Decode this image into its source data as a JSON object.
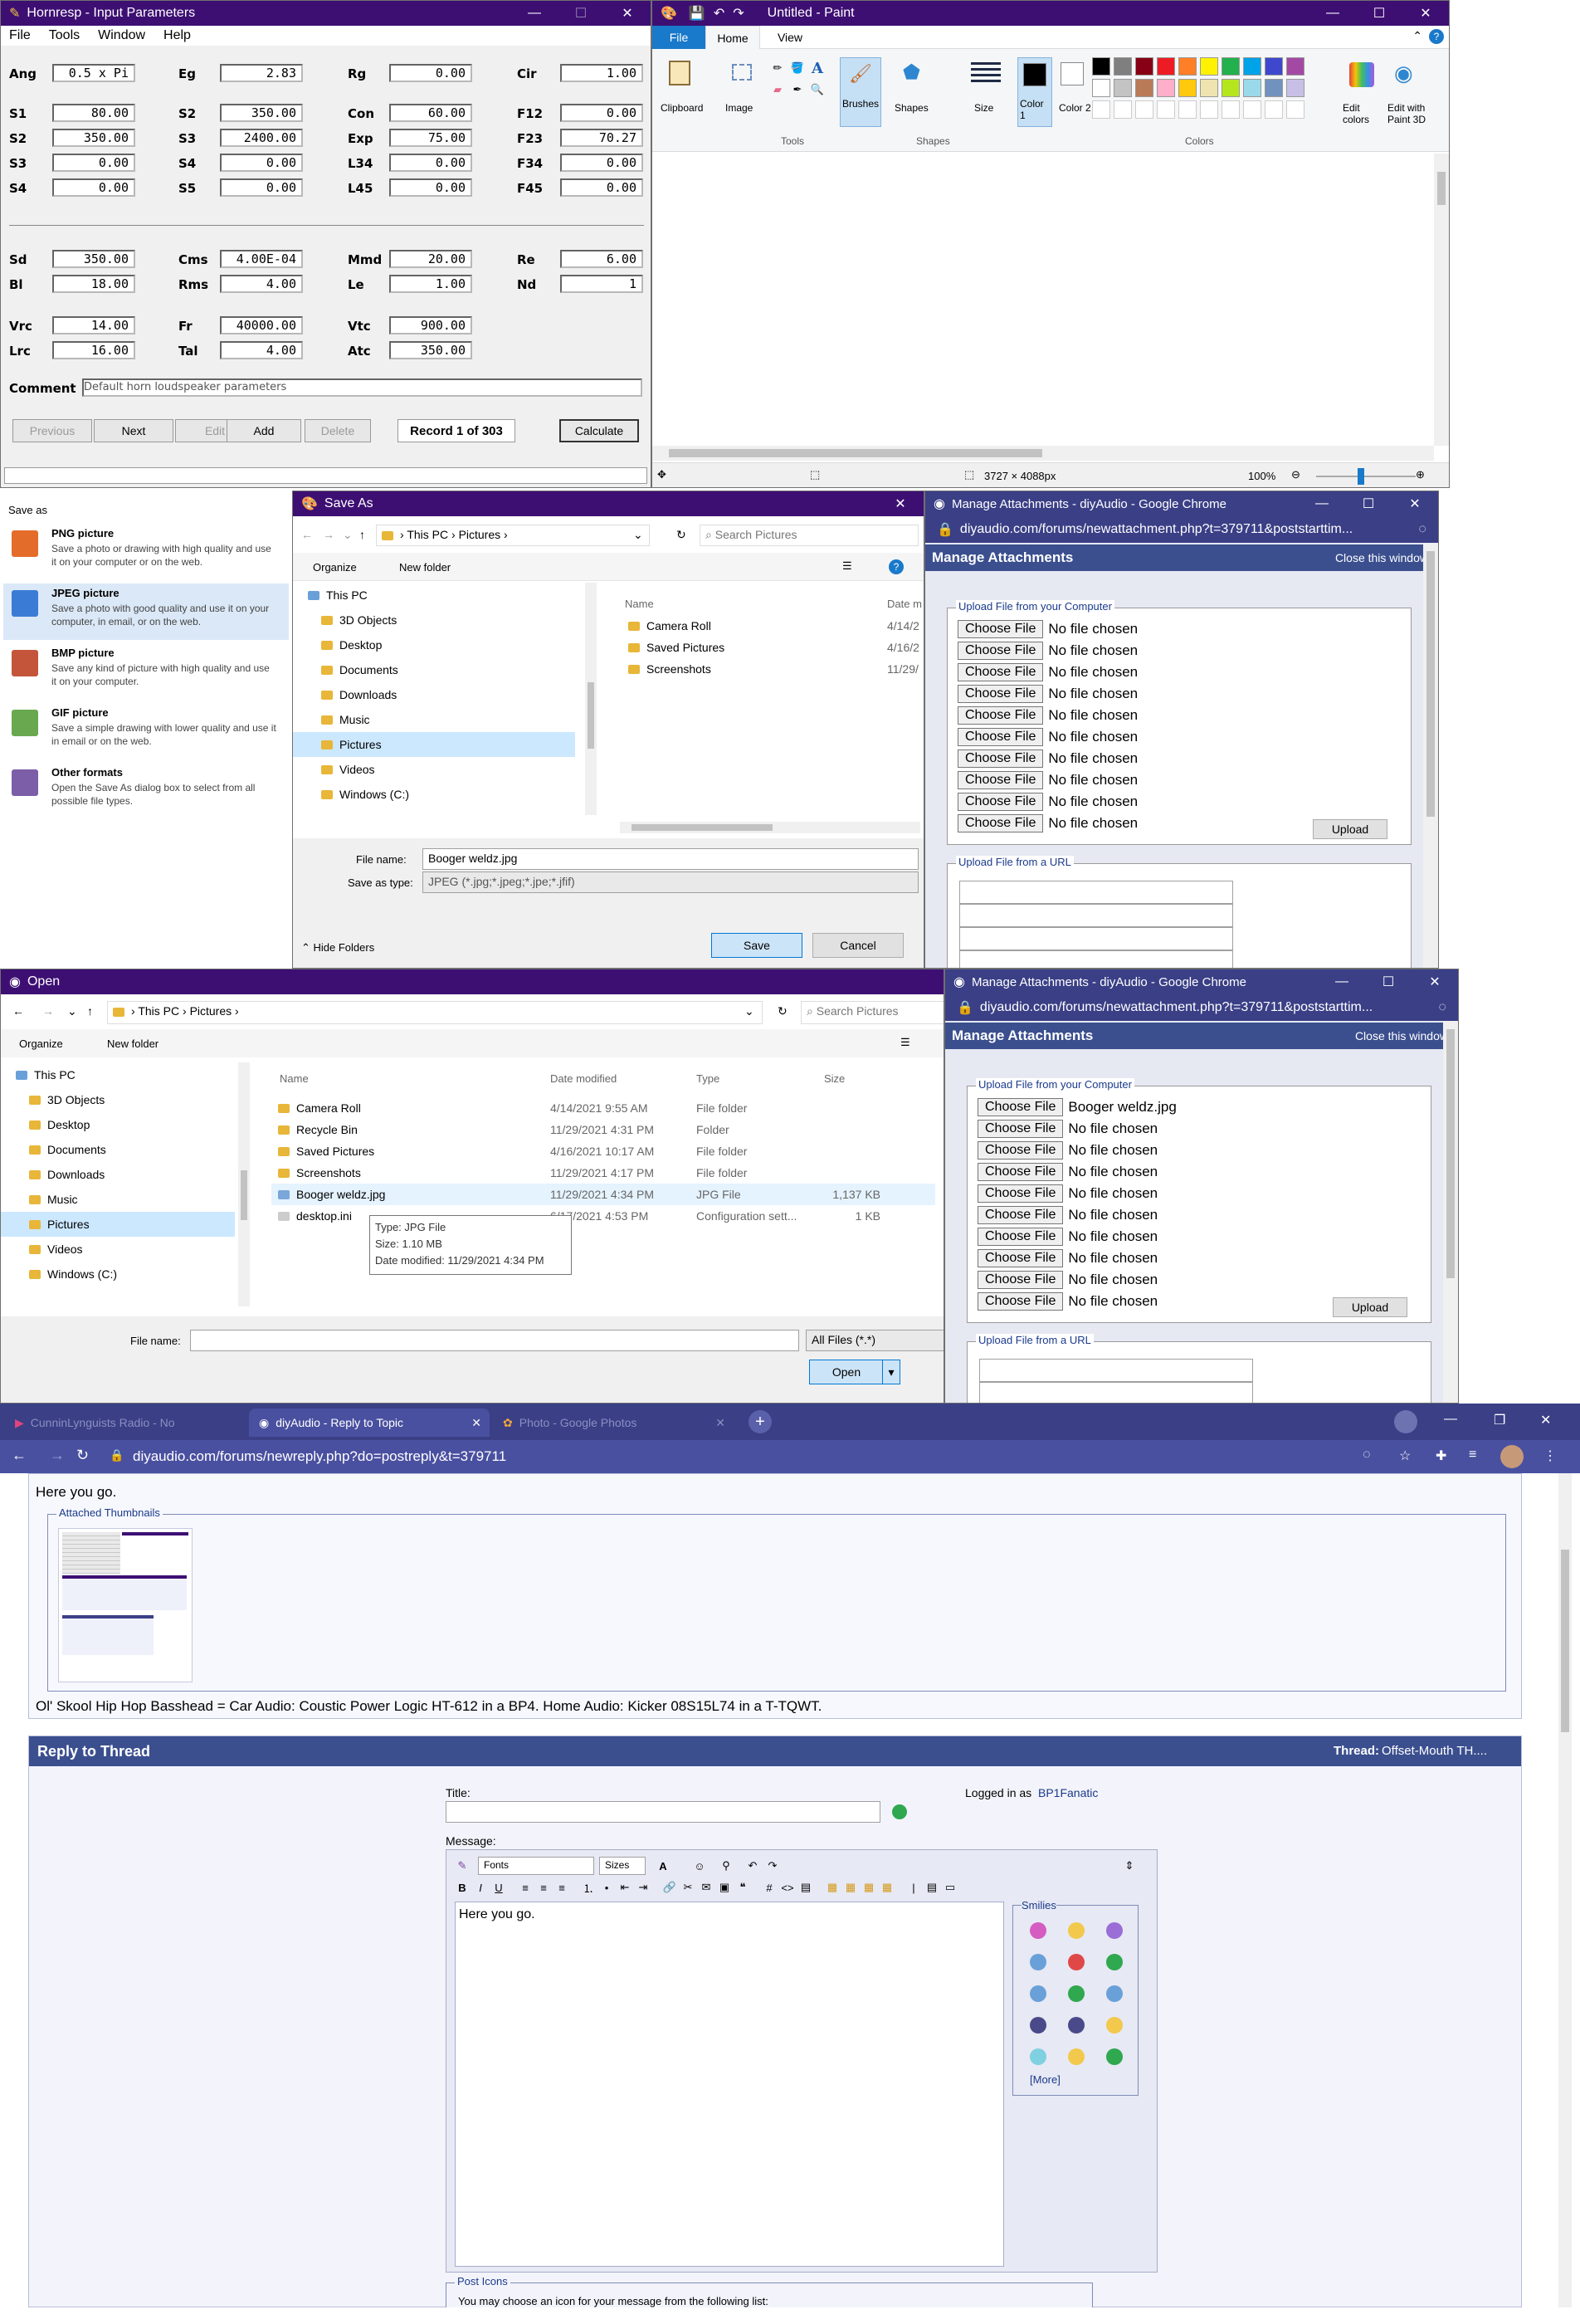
{
  "hornresp": {
    "title": "Hornresp - Input Parameters",
    "menu": [
      "File",
      "Tools",
      "Window",
      "Help"
    ],
    "params": [
      {
        "label": "Ang",
        "value": "0.5 x Pi"
      },
      {
        "label": "Eg",
        "value": "2.83"
      },
      {
        "label": "Rg",
        "value": "0.00"
      },
      {
        "label": "Cir",
        "value": "1.00"
      },
      {
        "label": "S1",
        "value": "80.00"
      },
      {
        "label": "S2",
        "value": "350.00"
      },
      {
        "label": "Con",
        "value": "60.00"
      },
      {
        "label": "F12",
        "value": "0.00"
      },
      {
        "label": "S2",
        "value": "350.00"
      },
      {
        "label": "S3",
        "value": "2400.00"
      },
      {
        "label": "Exp",
        "value": "75.00"
      },
      {
        "label": "F23",
        "value": "70.27"
      },
      {
        "label": "S3",
        "value": "0.00"
      },
      {
        "label": "S4",
        "value": "0.00"
      },
      {
        "label": "L34",
        "value": "0.00"
      },
      {
        "label": "F34",
        "value": "0.00"
      },
      {
        "label": "S4",
        "value": "0.00"
      },
      {
        "label": "S5",
        "value": "0.00"
      },
      {
        "label": "L45",
        "value": "0.00"
      },
      {
        "label": "F45",
        "value": "0.00"
      },
      {
        "label": "Sd",
        "value": "350.00"
      },
      {
        "label": "Cms",
        "value": "4.00E-04"
      },
      {
        "label": "Mmd",
        "value": "20.00"
      },
      {
        "label": "Re",
        "value": "6.00"
      },
      {
        "label": "Bl",
        "value": "18.00"
      },
      {
        "label": "Rms",
        "value": "4.00"
      },
      {
        "label": "Le",
        "value": "1.00"
      },
      {
        "label": "Nd",
        "value": "1"
      },
      {
        "label": "Vrc",
        "value": "14.00"
      },
      {
        "label": "Fr",
        "value": "40000.00"
      },
      {
        "label": "Vtc",
        "value": "900.00"
      },
      {
        "label": "Lrc",
        "value": "16.00"
      },
      {
        "label": "Tal",
        "value": "4.00"
      },
      {
        "label": "Atc",
        "value": "350.00"
      }
    ],
    "comment_label": "Comment",
    "comment_value": "Default horn loudspeaker parameters",
    "buttons": {
      "previous": "Previous",
      "next": "Next",
      "edit": "Edit",
      "add": "Add",
      "delete": "Delete",
      "calculate": "Calculate"
    },
    "record": "Record 1 of 303"
  },
  "paint": {
    "title": "Untitled - Paint",
    "tabs": [
      "File",
      "Home",
      "View"
    ],
    "groups": {
      "clipboard": "Clipboard",
      "image": "Image",
      "tools": "Tools",
      "brushes": "Brushes",
      "shapes_btn": "Shapes",
      "shapes_grp": "Shapes",
      "size": "Size",
      "color1": "Color 1",
      "color2": "Color 2",
      "edit_colors": "Edit colors",
      "edit_paint3d": "Edit with Paint 3D",
      "colors": "Colors"
    },
    "status_dims": "3727 × 4088px",
    "zoom": "100%",
    "palette": [
      "#000000",
      "#7f7f7f",
      "#880015",
      "#ed1c24",
      "#ff7f27",
      "#fff200",
      "#22b14c",
      "#00a2e8",
      "#3f48cc",
      "#a349a4",
      "#ffffff",
      "#c3c3c3",
      "#b97a57",
      "#ffaec9",
      "#ffc90e",
      "#efe4b0",
      "#b5e61d",
      "#99d9ea",
      "#7092be",
      "#c8bfe7"
    ]
  },
  "save_as_panel": {
    "header": "Save as",
    "items": [
      {
        "title": "PNG picture",
        "desc": "Save a photo or drawing with high quality and use it on your computer or on the web."
      },
      {
        "title": "JPEG picture",
        "desc": "Save a photo with good quality and use it on your computer, in email, or on the web."
      },
      {
        "title": "BMP picture",
        "desc": "Save any kind of picture with high quality and use it on your computer."
      },
      {
        "title": "GIF picture",
        "desc": "Save a simple drawing with lower quality and use it in email or on the web."
      },
      {
        "title": "Other formats",
        "desc": "Open the Save As dialog box to select from all possible file types."
      }
    ]
  },
  "save_dialog": {
    "title": "Save As",
    "path": [
      "This PC",
      "Pictures"
    ],
    "search": "Search Pictures",
    "organize": "Organize",
    "new_folder": "New folder",
    "nav": [
      "This PC",
      "3D Objects",
      "Desktop",
      "Documents",
      "Downloads",
      "Music",
      "Pictures",
      "Videos",
      "Windows (C:)"
    ],
    "col_name": "Name",
    "col_date": "Date m",
    "files": [
      {
        "name": "Camera Roll",
        "date": "4/14/2"
      },
      {
        "name": "Saved Pictures",
        "date": "4/16/2"
      },
      {
        "name": "Screenshots",
        "date": "11/29/"
      }
    ],
    "filename_label": "File name:",
    "filename": "Booger weldz.jpg",
    "type_label": "Save as type:",
    "type": "JPEG (*.jpg;*.jpeg;*.jpe;*.jfif)",
    "hide": "Hide Folders",
    "save": "Save",
    "cancel": "Cancel"
  },
  "ma1": {
    "title": "Manage Attachments - diyAudio - Google Chrome",
    "url": "diyaudio.com/forums/newattachment.php?t=379711&poststarttim...",
    "header": "Manage Attachments",
    "close": "Close this window",
    "legend_computer": "Upload File from your Computer",
    "choose": "Choose File",
    "rows": [
      "No file chosen",
      "No file chosen",
      "No file chosen",
      "No file chosen",
      "No file chosen",
      "No file chosen",
      "No file chosen",
      "No file chosen",
      "No file chosen",
      "No file chosen"
    ],
    "upload": "Upload",
    "legend_url": "Upload File from a URL"
  },
  "open_dialog": {
    "title": "Open",
    "path": [
      "This PC",
      "Pictures"
    ],
    "search": "Search Pictures",
    "organize": "Organize",
    "new_folder": "New folder",
    "nav": [
      "This PC",
      "3D Objects",
      "Desktop",
      "Documents",
      "Downloads",
      "Music",
      "Pictures",
      "Videos",
      "Windows (C:)"
    ],
    "cols": [
      "Name",
      "Date modified",
      "Type",
      "Size"
    ],
    "files": [
      {
        "name": "Camera Roll",
        "date": "4/14/2021 9:55 AM",
        "type": "File folder",
        "size": ""
      },
      {
        "name": "Recycle Bin",
        "date": "11/29/2021 4:31 PM",
        "type": "Folder",
        "size": ""
      },
      {
        "name": "Saved Pictures",
        "date": "4/16/2021 10:17 AM",
        "type": "File folder",
        "size": ""
      },
      {
        "name": "Screenshots",
        "date": "11/29/2021 4:17 PM",
        "type": "File folder",
        "size": ""
      },
      {
        "name": "Booger weldz.jpg",
        "date": "11/29/2021 4:34 PM",
        "type": "JPG File",
        "size": "1,137 KB"
      },
      {
        "name": "desktop.ini",
        "date": "6/17/2021 4:53 PM",
        "type": "Configuration sett...",
        "size": "1 KB"
      }
    ],
    "tooltip": [
      "Type: JPG File",
      "Size: 1.10 MB",
      "Date modified: 11/29/2021 4:34 PM"
    ],
    "filename_label": "File name:",
    "filter": "All Files (*.*)",
    "open": "Open"
  },
  "ma2": {
    "title": "Manage Attachments - diyAudio - Google Chrome",
    "url": "diyaudio.com/forums/newattachment.php?t=379711&poststarttim...",
    "header": "Manage Attachments",
    "close": "Close this window",
    "legend_computer": "Upload File from your Computer",
    "choose": "Choose File",
    "rows": [
      "Booger weldz.jpg",
      "No file chosen",
      "No file chosen",
      "No file chosen",
      "No file chosen",
      "No file chosen",
      "No file chosen",
      "No file chosen",
      "No file chosen",
      "No file chosen"
    ],
    "upload": "Upload",
    "legend_url": "Upload File from a URL"
  },
  "browser": {
    "tabs": [
      "CunninLynguists Radio - No",
      "diyAudio - Reply to Topic",
      "Photo - Google Photos"
    ],
    "url": "diyaudio.com/forums/newreply.php?do=postreply&t=379711",
    "post_text": "Here you go.",
    "thumbs_legend": "Attached Thumbnails",
    "signature": "Ol' Skool Hip Hop Basshead = Car Audio: Coustic Power Logic HT-612 in a BP4. Home Audio: Kicker 08S15L74 in a T-TQWT.",
    "reply_header": "Reply to Thread",
    "thread_label": "Thread:",
    "thread_name": "Offset-Mouth TH....",
    "title_label": "Title:",
    "logged_label": "Logged in as",
    "logged_user": "BP1Fanatic",
    "message_label": "Message:",
    "fonts": "Fonts",
    "sizes": "Sizes",
    "message": "Here you go.",
    "smilies": "Smilies",
    "more": "[More]",
    "post_icons": "Post Icons",
    "post_icons_text": "You may choose an icon for your message from the following list:"
  }
}
